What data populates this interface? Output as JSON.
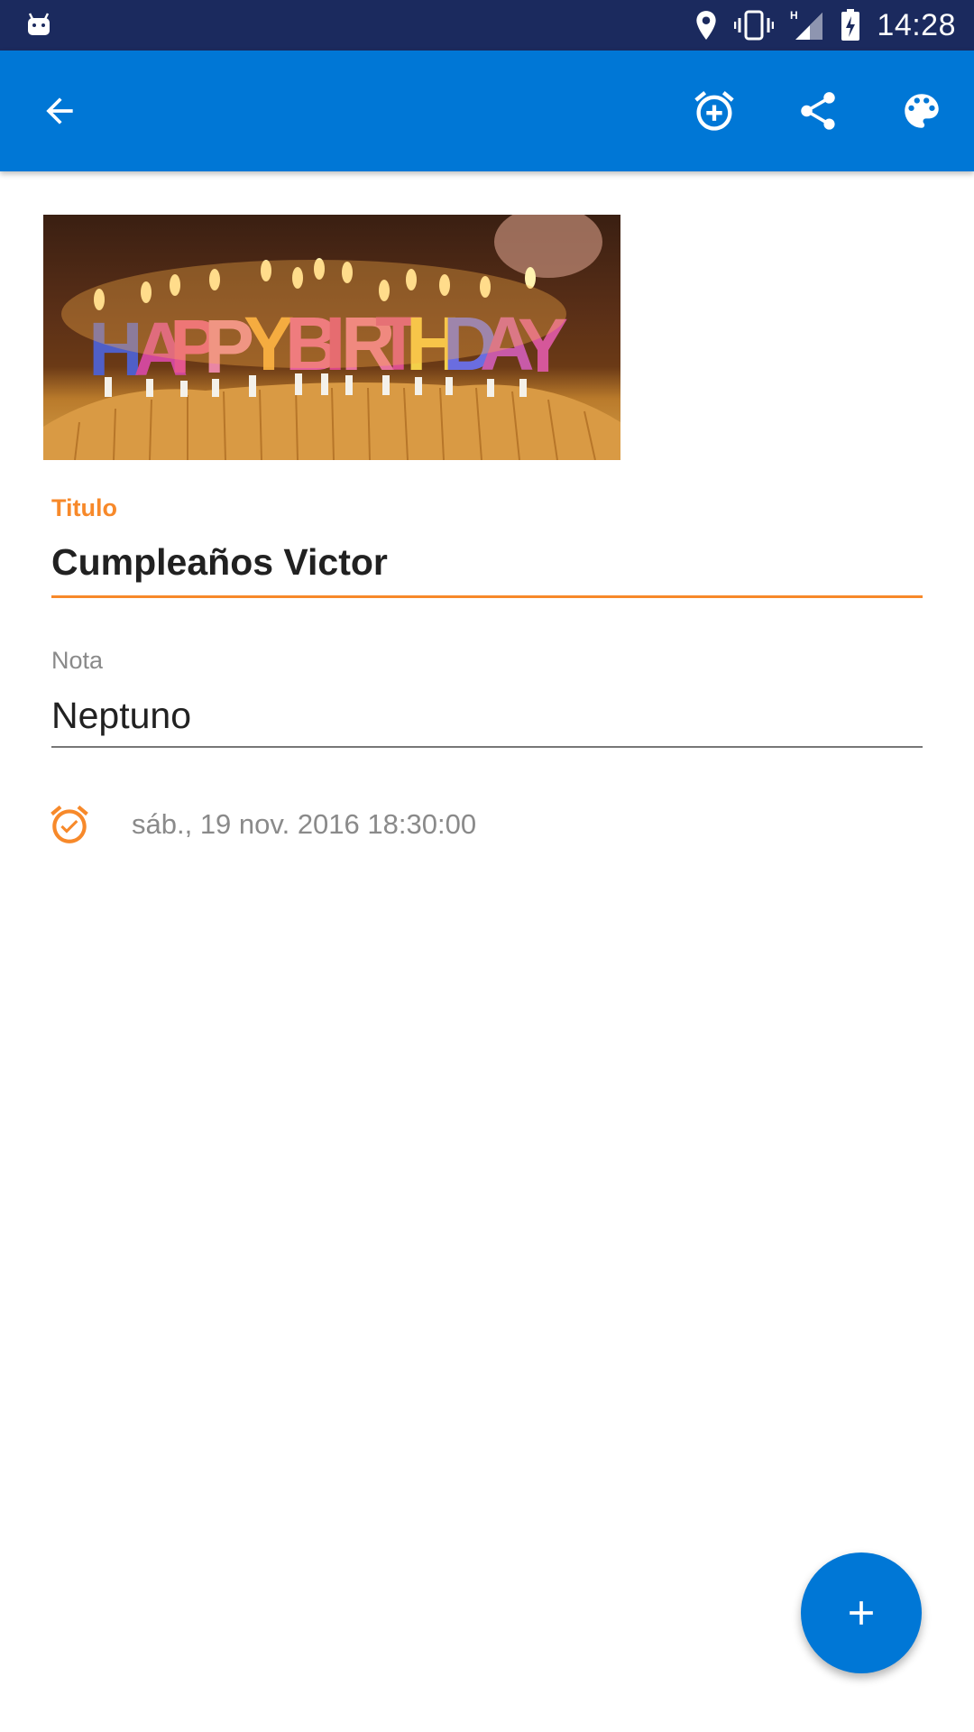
{
  "status_bar": {
    "time": "14:28",
    "icons": [
      "android-icon",
      "location-icon",
      "vibrate-icon",
      "signal-h-icon",
      "battery-charging-icon"
    ]
  },
  "app_bar": {
    "actions": [
      "back-arrow-icon",
      "add-alarm-icon",
      "share-icon",
      "palette-icon"
    ]
  },
  "hero_image": {
    "caption": "HAPPY BIRTHDAY"
  },
  "title_field": {
    "label": "Titulo",
    "value": "Cumpleaños Victor"
  },
  "note_field": {
    "label": "Nota",
    "value": "Neptuno"
  },
  "reminder": {
    "icon": "alarm-check-icon",
    "datetime": "sáb., 19 nov. 2016 18:30:00"
  },
  "fab": {
    "icon": "plus-icon"
  },
  "colors": {
    "primary": "#0077d6",
    "accent": "#f7892a",
    "status_bar": "#1b2a5e"
  }
}
